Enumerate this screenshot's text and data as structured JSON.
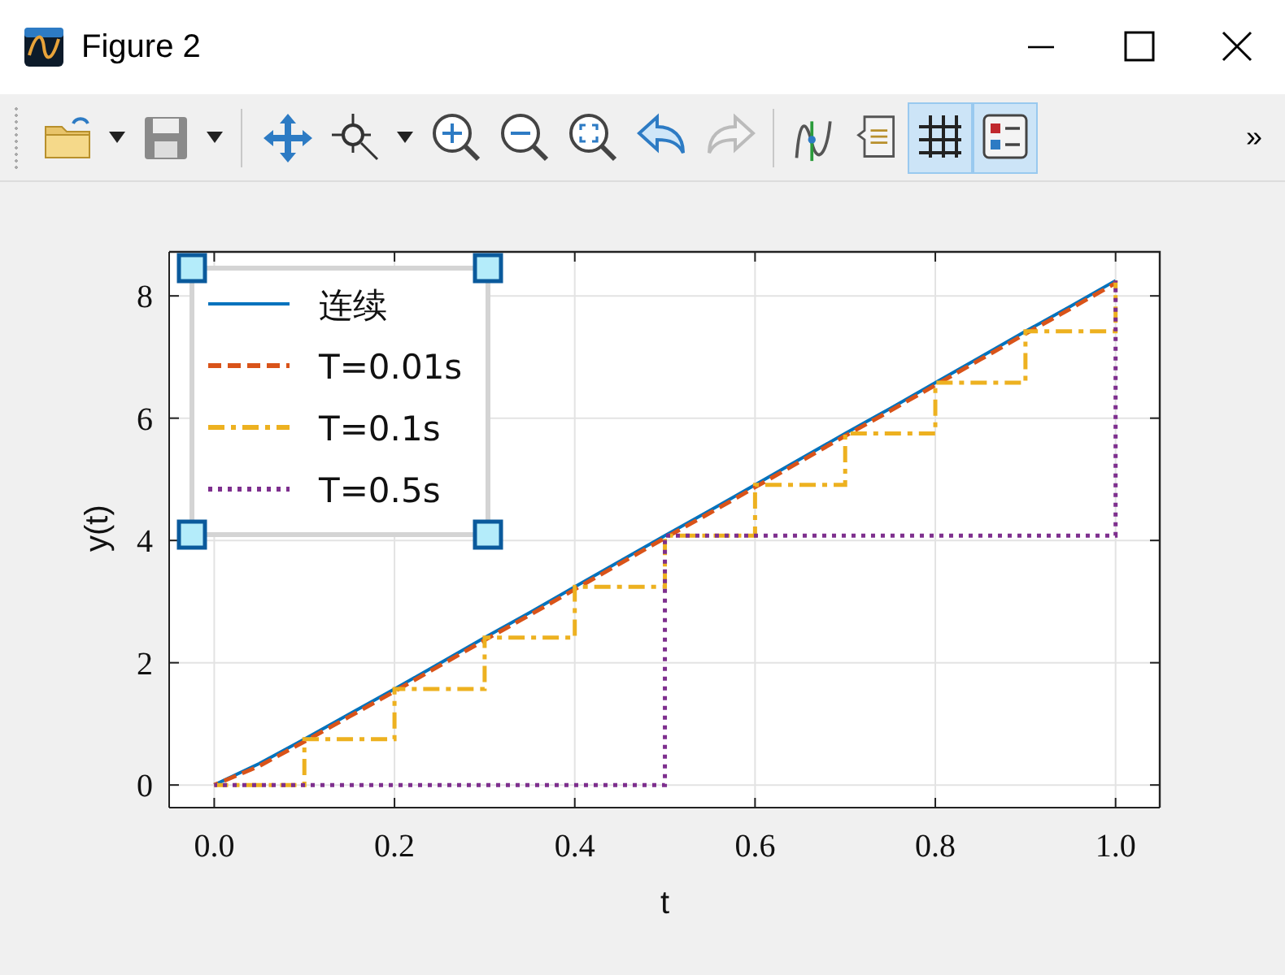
{
  "window": {
    "title": "Figure 2"
  },
  "toolbar": {
    "grid_pressed": true,
    "legend_pressed": true,
    "overflow": "»"
  },
  "axes": {
    "chart_data": {
      "type": "line",
      "xlabel": "t",
      "ylabel": "y(t)",
      "xlim": [
        -0.05,
        1.049
      ],
      "ylim": [
        -0.37,
        8.72
      ],
      "grid": true,
      "legend": true,
      "xticks": [
        {
          "value": 0,
          "label": "0.0"
        },
        {
          "value": 0.2,
          "label": "0.2"
        },
        {
          "value": 0.4,
          "label": "0.4"
        },
        {
          "value": 0.6,
          "label": "0.6"
        },
        {
          "value": 0.8,
          "label": "0.8"
        },
        {
          "value": 1,
          "label": "1.0"
        }
      ],
      "yticks": [
        {
          "value": 0,
          "label": "0"
        },
        {
          "value": 2,
          "label": "2"
        },
        {
          "value": 4,
          "label": "4"
        },
        {
          "value": 6,
          "label": "6"
        },
        {
          "value": 8,
          "label": "8"
        }
      ],
      "x": [
        0,
        0.05,
        0.1,
        0.1,
        0.15,
        0.2,
        0.2,
        0.25,
        0.3,
        0.3,
        0.35,
        0.4,
        0.4,
        0.45,
        0.5,
        0.5,
        0.55,
        0.6,
        0.6,
        0.65,
        0.7,
        0.7,
        0.75,
        0.8,
        0.8,
        0.85,
        0.9,
        0.9,
        0.95,
        1,
        1
      ],
      "series": [
        {
          "name": "连续",
          "color": "#0072bd",
          "line_style": "solid",
          "values": [
            0,
            0.35,
            0.75,
            0.75,
            1.16,
            1.57,
            1.57,
            1.99,
            2.41,
            2.41,
            2.82,
            3.24,
            3.24,
            3.66,
            4.08,
            4.08,
            4.49,
            4.91,
            4.91,
            5.33,
            5.75,
            5.75,
            6.16,
            6.58,
            6.58,
            7.0,
            7.42,
            7.42,
            7.83,
            8.25,
            8.25
          ]
        },
        {
          "name": "T=0.01s",
          "color": "#d95319",
          "line_style": "dashed",
          "values": [
            0,
            0.31,
            0.71,
            0.71,
            1.12,
            1.53,
            1.53,
            1.95,
            2.37,
            2.37,
            2.78,
            3.2,
            3.2,
            3.62,
            4.04,
            4.04,
            4.45,
            4.87,
            4.87,
            5.29,
            5.71,
            5.71,
            6.12,
            6.54,
            6.54,
            6.96,
            7.38,
            7.38,
            7.79,
            8.21,
            8.21
          ]
        },
        {
          "name": "T=0.1s",
          "color": "#edb120",
          "line_style": "dashdot",
          "values": [
            0,
            0,
            0,
            0.75,
            0.75,
            0.75,
            1.57,
            1.57,
            1.57,
            2.41,
            2.41,
            2.41,
            3.24,
            3.24,
            3.24,
            4.08,
            4.08,
            4.08,
            4.91,
            4.91,
            4.91,
            5.75,
            5.75,
            5.75,
            6.58,
            6.58,
            6.58,
            7.42,
            7.42,
            7.42,
            8.25
          ]
        },
        {
          "name": "T=0.5s",
          "color": "#7e2f8e",
          "line_style": "dotted",
          "values": [
            0,
            0,
            0,
            0,
            0,
            0,
            0,
            0,
            0,
            0,
            0,
            0,
            0,
            0,
            0,
            4.08,
            4.08,
            4.08,
            4.08,
            4.08,
            4.08,
            4.08,
            4.08,
            4.08,
            4.08,
            4.08,
            4.08,
            4.08,
            4.08,
            4.08,
            8.25
          ]
        }
      ]
    }
  }
}
